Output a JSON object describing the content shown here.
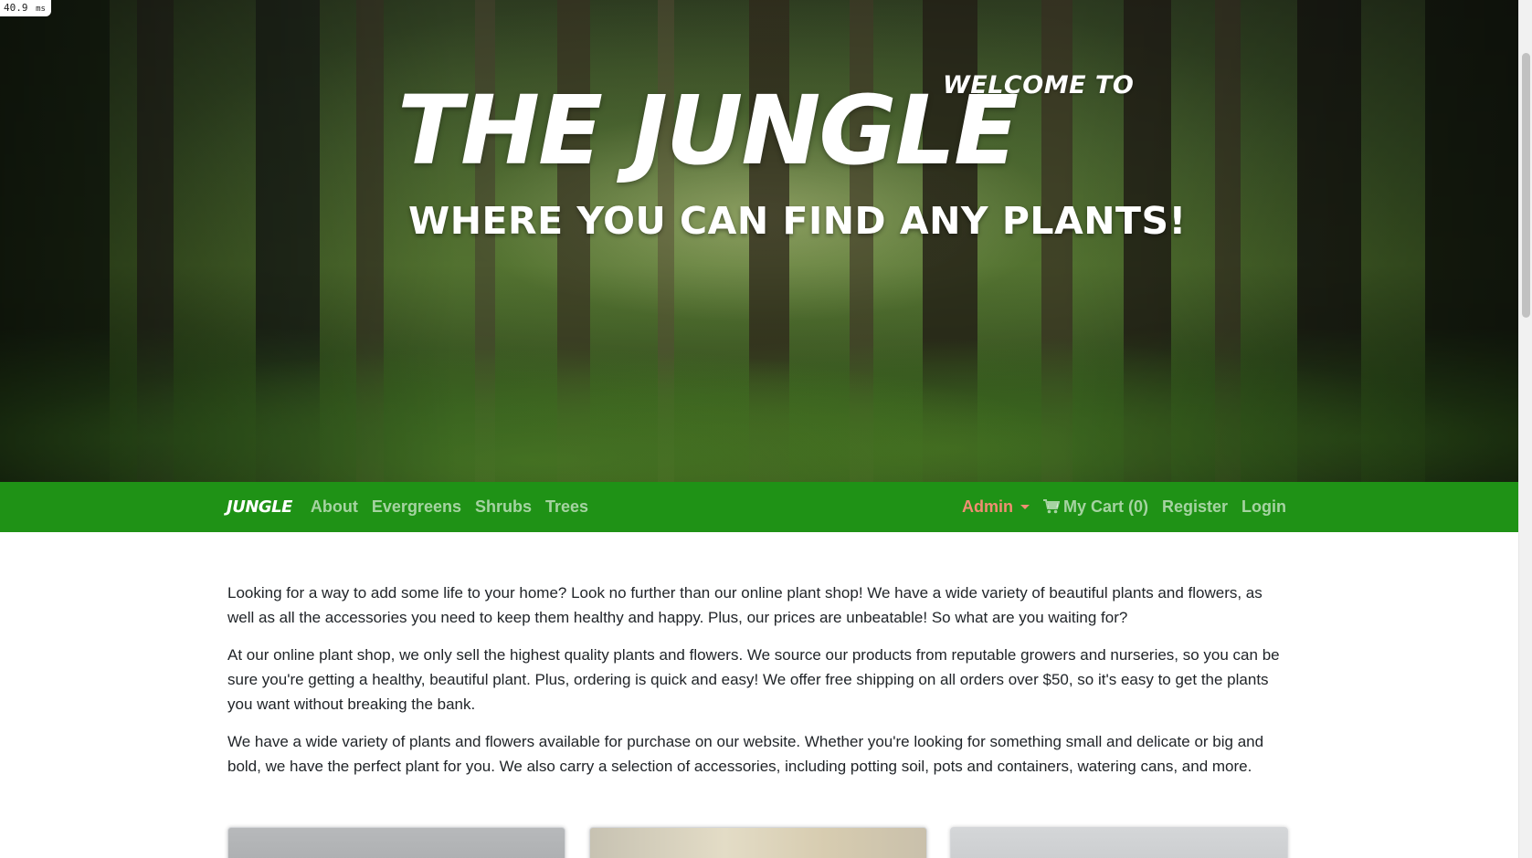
{
  "perf_badge": {
    "value": "40.9",
    "unit": "ms"
  },
  "hero": {
    "welcome": "WELCOME TO",
    "title": "THE JUNGLE",
    "subtitle": "WHERE YOU CAN FIND ANY PLANTS!"
  },
  "navbar": {
    "brand": "JUNGLE",
    "links": [
      "About",
      "Evergreens",
      "Shrubs",
      "Trees"
    ],
    "admin_label": "Admin",
    "cart_label": "My Cart (0)",
    "register_label": "Register",
    "login_label": "Login",
    "colors": {
      "background": "#1f9216",
      "admin": "#f08e72"
    }
  },
  "content": {
    "paragraphs": [
      "Looking for a way to add some life to your home? Look no further than our online plant shop! We have a wide variety of beautiful plants and flowers, as well as all the accessories you need to keep them healthy and happy. Plus, our prices are unbeatable! So what are you waiting for?",
      "At our online plant shop, we only sell the highest quality plants and flowers. We source our products from reputable growers and nurseries, so you can be sure you're getting a healthy, beautiful plant. Plus, ordering is quick and easy! We offer free shipping on all orders over $50, so it's easy to get the plants you want without breaking the bank.",
      "We have a wide variety of plants and flowers available for purchase on our website. Whether you're looking for something small and delicate or big and bold, we have the perfect plant for you. We also carry a selection of accessories, including potting soil, pots and containers, watering cans, and more."
    ]
  }
}
